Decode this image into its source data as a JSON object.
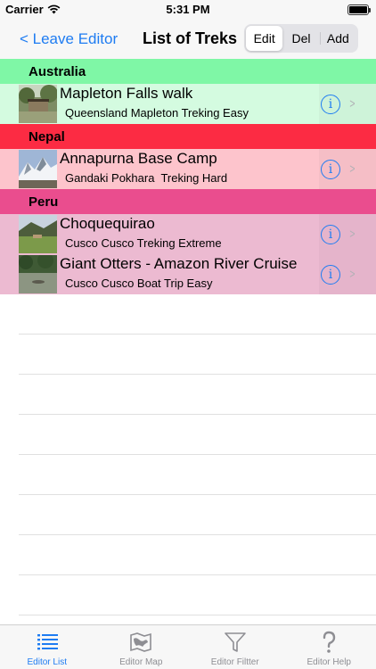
{
  "status_bar": {
    "carrier": "Carrier",
    "time": "5:31 PM"
  },
  "nav": {
    "back_label": "< Leave Editor",
    "title": "List of Treks",
    "segments": [
      "Edit",
      "Del",
      "Add"
    ],
    "selected_segment": "Edit"
  },
  "sections": [
    {
      "name": "Australia",
      "header_color": "#7ff7a6",
      "row_color": "#d4fbe0",
      "rows": [
        {
          "title": "Mapleton Falls walk",
          "subtitle": "Queensland Mapleton Treking Easy"
        }
      ]
    },
    {
      "name": "Nepal",
      "header_color": "#fc2b43",
      "row_color": "#fdc4cc",
      "rows": [
        {
          "title": "Annapurna Base Camp",
          "subtitle": "Gandaki Pokhara  Treking Hard"
        }
      ]
    },
    {
      "name": "Peru",
      "header_color": "#ea4d8e",
      "row_color": "#ecbad1",
      "rows": [
        {
          "title": "Choquequirao",
          "subtitle": "Cusco Cusco Treking Extreme"
        },
        {
          "title": "Giant Otters - Amazon River Cruise",
          "subtitle": "Cusco Cusco Boat Trip Easy"
        }
      ]
    }
  ],
  "tabs": [
    {
      "label": "Editor List",
      "icon": "list-icon",
      "active": true
    },
    {
      "label": "Editor Map",
      "icon": "map-icon",
      "active": false
    },
    {
      "label": "Editor Filtter",
      "icon": "filter-icon",
      "active": false
    },
    {
      "label": "Editor Help",
      "icon": "help-icon",
      "active": false
    }
  ],
  "colors": {
    "accent": "#1e7cf2",
    "bar_background": "#f7f7f7"
  }
}
